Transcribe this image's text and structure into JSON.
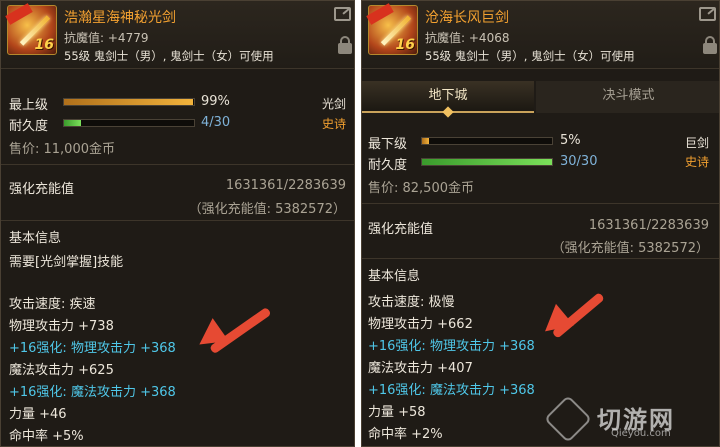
{
  "left": {
    "icon_level": "16",
    "name": "浩瀚星海神秘光剑",
    "resist_label": "抗魔值:",
    "resist_value": "+4779",
    "usable": "55级 鬼剑士（男）, 鬼剑士（女）可使用",
    "grade_label": "最上级",
    "grade_pct": "99%",
    "grade_fill": 0.99,
    "durability_label": "耐久度",
    "durability_value": "4/30",
    "durability_fill": 0.13,
    "weapon_type": "光剑",
    "rarity": "史诗",
    "price": "售价: 11,000金币",
    "amp_label": "强化充能值",
    "amp_value": "1631361/2283639",
    "amp_sub": "（强化充能值: 5382572）",
    "basic_info": "基本信息",
    "requirement": "需要[光剑掌握]技能",
    "stats": [
      {
        "text": "攻击速度: 疾速",
        "color": "white"
      },
      {
        "text": "物理攻击力 +738",
        "color": "white"
      },
      {
        "text": "+16强化: 物理攻击力 +368",
        "color": "cyan"
      },
      {
        "text": "魔法攻击力 +625",
        "color": "white"
      },
      {
        "text": "+16强化: 魔法攻击力 +368",
        "color": "cyan"
      },
      {
        "text": "力量 +46",
        "color": "white"
      },
      {
        "text": "命中率 +5%",
        "color": "white"
      }
    ]
  },
  "right": {
    "icon_level": "16",
    "name": "沧海长风巨剑",
    "resist_label": "抗魔值:",
    "resist_value": "+4068",
    "usable": "55级 鬼剑士（男）, 鬼剑士（女）可使用",
    "tab_active": "地下城",
    "tab_inactive": "决斗模式",
    "grade_label": "最下级",
    "grade_pct": "5%",
    "grade_fill": 0.05,
    "durability_label": "耐久度",
    "durability_value": "30/30",
    "durability_fill": 1.0,
    "weapon_type": "巨剑",
    "rarity": "史诗",
    "price": "售价: 82,500金币",
    "amp_label": "强化充能值",
    "amp_value": "1631361/2283639",
    "amp_sub": "（强化充能值: 5382572）",
    "basic_info": "基本信息",
    "stats": [
      {
        "text": "攻击速度: 极慢",
        "color": "white"
      },
      {
        "text": "物理攻击力 +662",
        "color": "white"
      },
      {
        "text": "+16强化: 物理攻击力 +368",
        "color": "cyan"
      },
      {
        "text": "魔法攻击力 +407",
        "color": "white"
      },
      {
        "text": "+16强化: 魔法攻击力 +368",
        "color": "cyan"
      },
      {
        "text": "力量 +58",
        "color": "white"
      },
      {
        "text": "命中率 +2%",
        "color": "white"
      }
    ]
  },
  "watermark": {
    "text": "切游网",
    "sub": "Qieyou.com"
  },
  "colors": {
    "item_name": "#f2a030",
    "enhance_cyan": "#4fc7e8",
    "arrow": "#e64a33"
  }
}
